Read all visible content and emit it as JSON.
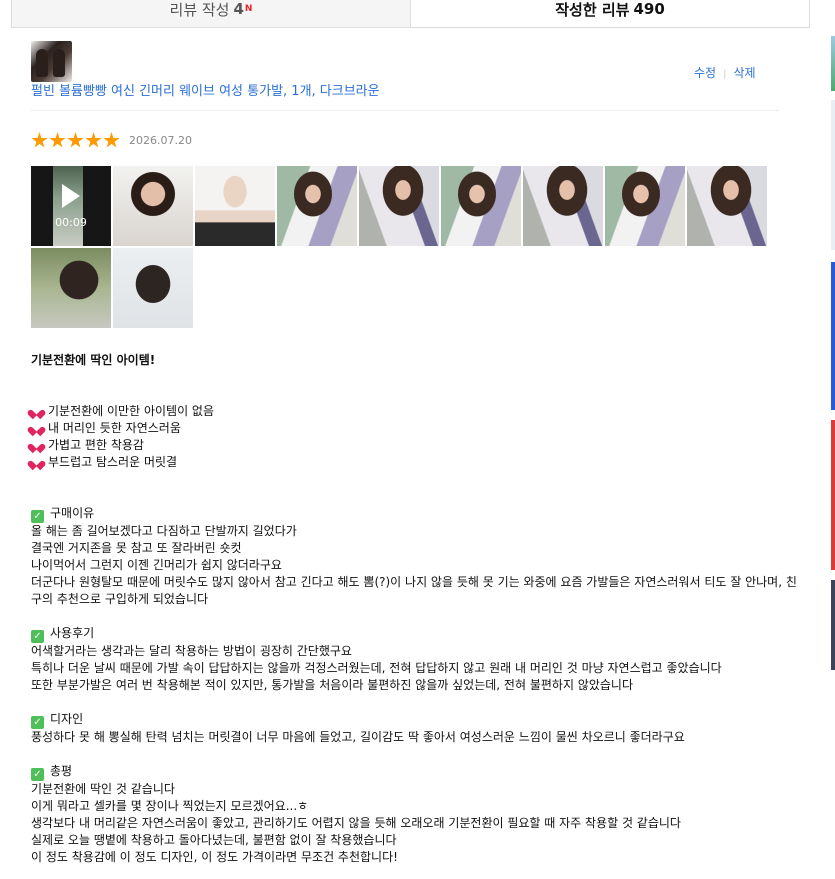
{
  "tabs": {
    "write": {
      "label": "리뷰 작성",
      "count": "4",
      "badge": "N"
    },
    "written": {
      "label": "작성한 리뷰",
      "count": "490"
    }
  },
  "product": {
    "name": "펄빈 볼륨빵빵 여신 긴머리 웨이브 여성 통가발, 1개, 다크브라운",
    "edit": "수정",
    "delete": "삭제"
  },
  "review": {
    "stars": 5,
    "date": "2026.07.20",
    "video_duration": "00:09",
    "headline": "기분전환에 딱인 아이템!",
    "highlights": [
      "기분전환에 이만한 아이템이 없음",
      "내 머리인 듯한 자연스러움",
      "가볍고 편한 착용감",
      "부드럽고 탐스러운 머릿결"
    ],
    "sections": [
      {
        "title": "구매이유",
        "lines": [
          "올 해는 좀 길어보겠다고 다짐하고 단발까지 길었다가",
          "결국엔 거지존을 못 참고 또 잘라버린 숏컷",
          "나이먹어서 그런지 이젠 긴머리가 쉽지 않더라구요",
          "더군다나 원형탈모 때문에 머릿수도 많지 않아서 참고 긴다고 해도 뽐(?)이 나지 않을 듯해 못 기는 와중에 요즘 가발들은 자연스러워서 티도 잘 안나며, 친구의 추천으로 구입하게 되었습니다"
        ]
      },
      {
        "title": "사용후기",
        "lines": [
          "어색할거라는 생각과는 달리 착용하는 방법이 굉장히 간단했구요",
          "특히나 더운 날씨 때문에 가발 속이 답답하지는 않을까 걱정스러웠는데, 전혀 답답하지 않고 원래 내 머리인 것 마냥 자연스럽고 좋았습니다",
          "또한 부분가발은 여러 번 착용해본 적이 있지만, 통가발을 처음이라 불편하진 않을까 싶었는데, 전혀 불편하지 않았습니다"
        ]
      },
      {
        "title": "디자인",
        "lines": [
          "풍성하다 못 해 뽕실해 탄력 넘치는 머릿결이 너무 마음에 들었고, 길이감도 딱 좋아서 여성스러운 느낌이 물씬 차오르니 좋더라구요"
        ]
      },
      {
        "title": "총평",
        "lines": [
          "기분전환에 딱인 것 같습니다",
          "이게 뭐라고 셀카를 몇 장이나 찍었는지 모르겠어요...ㅎ",
          "생각보다 내 머리같은 자연스러움이 좋았고, 관리하기도 어렵지 않을 듯해 오래오래 기분전환이 필요할 때 자주 착용할 것 같습니다",
          "실제로 오늘 땡볕에 착용하고 돌아다녔는데, 불편함 없이 잘 착용했습니다",
          "이 정도 착용감에 이 정도 디자인, 이 정도 가격이라면 무조건 추천합니다!"
        ]
      }
    ]
  },
  "colors": {
    "link": "#2b6fd6",
    "star": "#fd9a00",
    "badge": "#e52528",
    "check": "#4fbf5a",
    "heart": "#e0245e"
  }
}
